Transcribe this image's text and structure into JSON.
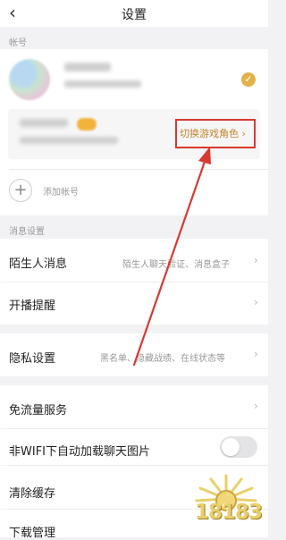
{
  "header": {
    "title": "设置",
    "back_icon": "chevron-left-icon"
  },
  "accounts": {
    "section_label": "帐号",
    "switch_role_label": "切换游戏角色",
    "add_account_label": "添加帐号"
  },
  "messages": {
    "section_label": "消息设置",
    "stranger": {
      "label": "陌生人消息",
      "value": "陌生人聊天验证、消息盒子"
    },
    "live_reminder": {
      "label": "开播提醒"
    }
  },
  "privacy": {
    "label": "隐私设置",
    "value": "黑名单、隐藏战绩、在线状态等"
  },
  "general": {
    "free_data": {
      "label": "免流量服务"
    },
    "auto_load_images": {
      "label": "非WIFI下自动加载聊天图片",
      "enabled": false
    },
    "clear_cache": {
      "label": "清除缓存"
    },
    "download_manager": {
      "label": "下载管理"
    }
  },
  "watermark": {
    "text": "18183"
  },
  "colors": {
    "accent_gold": "#c2852c",
    "highlight_red": "#d63a32",
    "check_gold": "#e2b24a"
  }
}
